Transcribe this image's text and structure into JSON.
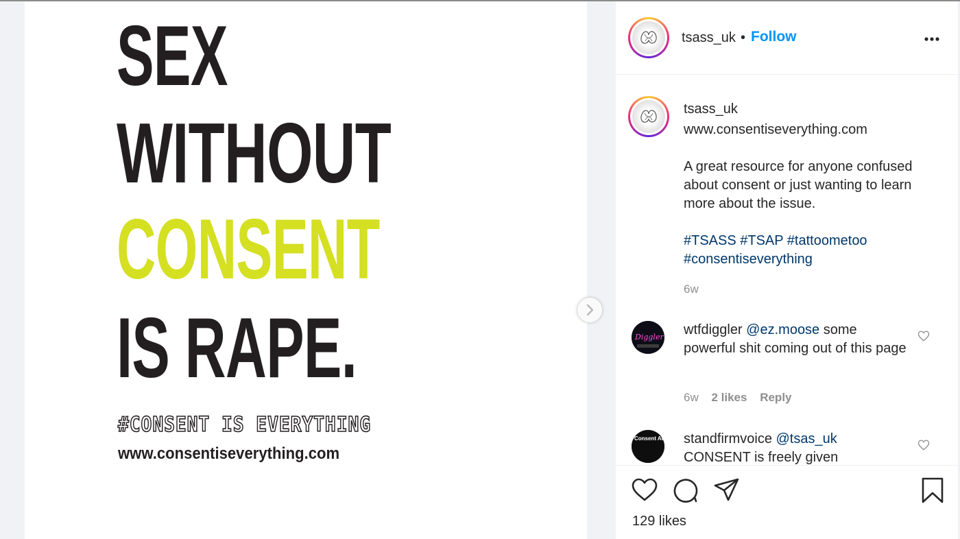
{
  "post_image": {
    "line1": "SEX",
    "line2": "WITHOUT",
    "line3": "CONSENT",
    "line4": "IS RAPE.",
    "hashtag_line": "#CONSENT IS EVERYTHING",
    "website_line": "www.consentiseverything.com",
    "highlight_color": "#d4e021"
  },
  "header": {
    "username": "tsass_uk",
    "separator": "•",
    "follow_label": "Follow"
  },
  "caption": {
    "username": "tsass_uk",
    "text": "www.consentiseverything.com\n\nA great resource for anyone confused about consent or just wanting to learn more about the issue.\n\n",
    "hashtags_line1": "#TSASS #TSAP #tattoometoo",
    "hashtags_line2": "#consentiseverything",
    "time": "6w"
  },
  "comments": [
    {
      "username": "wtfdiggler",
      "mention": "@ez.moose",
      "text": " some powerful shit coming out of this page",
      "time": "6w",
      "likes": "2 likes",
      "reply_label": "Reply",
      "avatar_text": "Diggler!"
    },
    {
      "username": "standfirmvoice",
      "mention": "@tsas_uk",
      "text": "CONSENT is freely given",
      "avatar_text": "Consent Awareness Network"
    }
  ],
  "footer": {
    "likes_count": "129 likes"
  },
  "icons": [
    "chevron-right-icon",
    "more-horizontal-icon",
    "heart-icon",
    "comment-icon",
    "share-icon",
    "bookmark-icon"
  ]
}
